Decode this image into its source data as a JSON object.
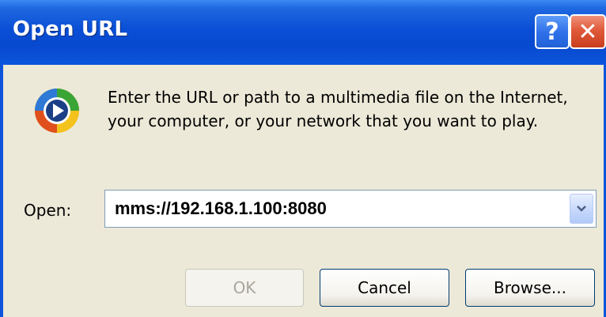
{
  "window": {
    "title": "Open URL",
    "help_label": "?",
    "close_label": "✕"
  },
  "message": "Enter the URL or path to a multimedia file on the Internet, your computer, or your network that you want to play.",
  "open_field": {
    "label": "Open:",
    "value": "mms://192.168.1.100:8080"
  },
  "buttons": {
    "ok": "OK",
    "cancel": "Cancel",
    "browse": "Browse..."
  },
  "colors": {
    "titlebar": "#0a4fd6",
    "dialog_bg": "#ece9d8",
    "close_red": "#e05a3a",
    "disabled_text": "#a9a69a"
  },
  "icons": {
    "app": "windows-media-player-icon",
    "dropdown": "chevron-down-icon"
  }
}
